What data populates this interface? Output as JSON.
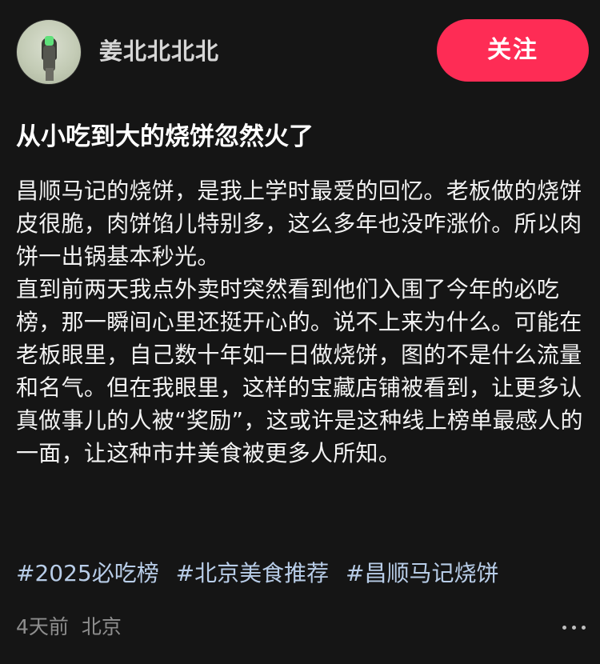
{
  "author": {
    "name": "姜北北北北",
    "avatar_icon": "user-avatar-photo"
  },
  "follow_button": {
    "label": "关注",
    "color": "#fe2c55"
  },
  "post": {
    "title": "从小吃到大的烧饼忽然火了",
    "paragraphs": [
      "昌顺马记的烧饼，是我上学时最爱的回忆。老板做的烧饼皮很脆，肉饼馅儿特别多，这么多年也没咋涨价。所以肉饼一出锅基本秒光。",
      "直到前两天我点外卖时突然看到他们入围了今年的必吃榜，那一瞬间心里还挺开心的。说不上来为什么。可能在老板眼里，自己数十年如一日做烧饼，图的不是什么流量和名气。但在我眼里，这样的宝藏店铺被看到，让更多认真做事儿的人被“奖励”，这或许是这种线上榜单最感人的一面，让这种市井美食被更多人所知。"
    ],
    "tags": [
      "#2025必吃榜",
      "#北京美食推荐",
      "#昌顺马记烧饼"
    ],
    "time": "4天前",
    "location": "北京"
  },
  "more_button": {
    "icon": "more-dots-icon"
  },
  "colors": {
    "background": "#151515",
    "tag": "#b8cde8",
    "meta": "#8e8e8e"
  }
}
